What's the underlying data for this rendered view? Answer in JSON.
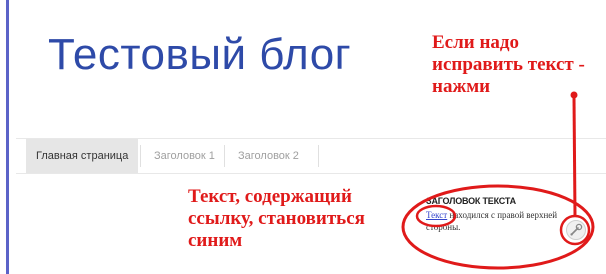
{
  "blog": {
    "title": "Тестовый блог"
  },
  "nav": {
    "items": [
      {
        "label": "Главная страница"
      },
      {
        "label": "Заголовок 1"
      },
      {
        "label": "Заголовок 2"
      }
    ]
  },
  "widget": {
    "heading": "ЗАГОЛОВОК ТЕКСТА",
    "link_text": "Текст",
    "body_text": " находился с правой верхней стороны."
  },
  "annotations": {
    "edit_hint": [
      "Если надо",
      "исправить текст -",
      "нажми"
    ],
    "link_hint": [
      "Текст, содержащий",
      "ссылку, становиться",
      "синим"
    ]
  },
  "colors": {
    "title": "#2e4aa8",
    "annotation": "#e01a1a",
    "link": "#3344cc",
    "left_border": "#5b63c8"
  },
  "icons": {
    "edit": "wrench-icon"
  }
}
